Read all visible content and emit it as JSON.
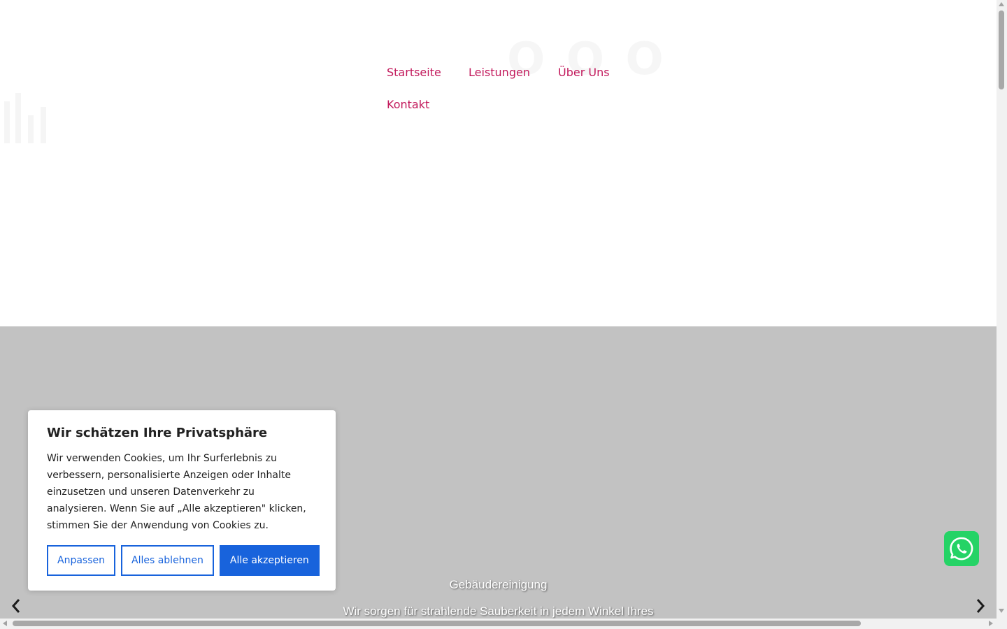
{
  "nav": {
    "items": [
      "Startseite",
      "Leistungen",
      "Über Uns",
      "Kontakt"
    ]
  },
  "hero": {
    "slide_title": "Gebäudereinigung",
    "slide_text": "Wir sorgen für strahlende Sauberkeit in jedem Winkel Ihres",
    "prev_icon": "chevron-left-icon",
    "next_icon": "chevron-right-icon"
  },
  "cookie_banner": {
    "title": "Wir schätzen Ihre Privatsphäre",
    "text": "Wir verwenden Cookies, um Ihr Surferlebnis zu verbessern, personalisierte Anzeigen oder Inhalte einzusetzen und unseren Datenverkehr zu analysieren. Wenn Sie auf „Alle akzeptieren\" klicken, stimmen Sie der Anwendung von Cookies zu.",
    "customize_label": "Anpassen",
    "reject_label": "Alles ablehnen",
    "accept_label": "Alle akzeptieren"
  },
  "whatsapp": {
    "icon": "whatsapp-icon"
  },
  "colors": {
    "nav_link": "#c2185b",
    "hero_bg": "#c2c2c2",
    "cookie_accent": "#1863dc",
    "whatsapp": "#25d366"
  }
}
